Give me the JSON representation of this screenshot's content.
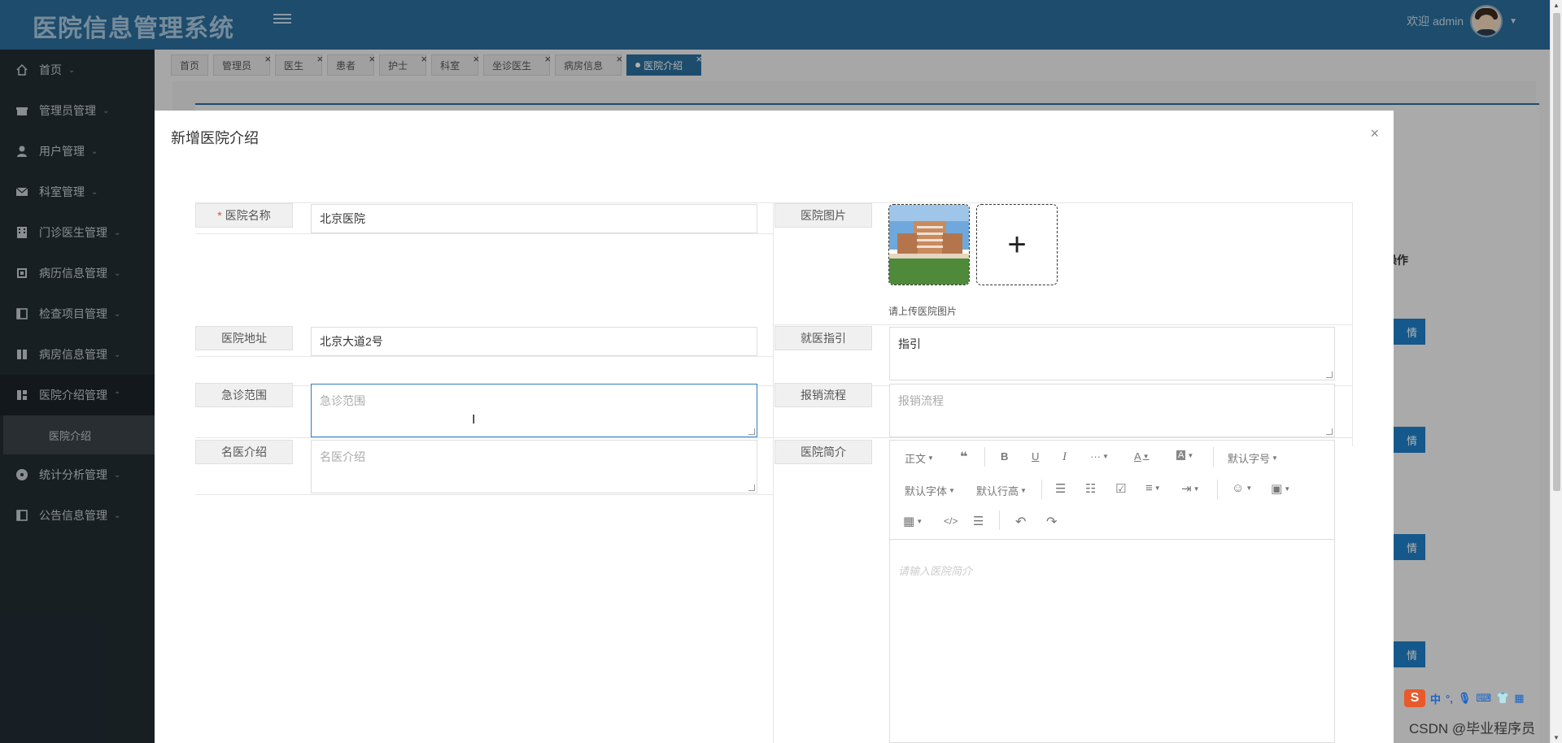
{
  "app": {
    "title": "医院信息管理系统",
    "welcome": "欢迎 admin"
  },
  "sidebar": {
    "items": [
      {
        "label": "首页",
        "icon": "home-icon"
      },
      {
        "label": "管理员管理",
        "icon": "gift-icon"
      },
      {
        "label": "用户管理",
        "icon": "user-icon"
      },
      {
        "label": "科室管理",
        "icon": "envelope-icon"
      },
      {
        "label": "门诊医生管理",
        "icon": "building-icon"
      },
      {
        "label": "病历信息管理",
        "icon": "chip-icon"
      },
      {
        "label": "检查项目管理",
        "icon": "panel-icon"
      },
      {
        "label": "病房信息管理",
        "icon": "columns-icon"
      },
      {
        "label": "医院介绍管理",
        "icon": "grid-icon"
      },
      {
        "label": "统计分析管理",
        "icon": "circle-icon"
      },
      {
        "label": "公告信息管理",
        "icon": "panel-icon"
      }
    ],
    "sub_item": "医院介绍"
  },
  "tabs": [
    {
      "label": "首页",
      "closable": false
    },
    {
      "label": "管理员",
      "closable": true
    },
    {
      "label": "医生",
      "closable": true
    },
    {
      "label": "患者",
      "closable": true
    },
    {
      "label": "护士",
      "closable": true
    },
    {
      "label": "科室",
      "closable": true
    },
    {
      "label": "坐诊医生",
      "closable": true
    },
    {
      "label": "病房信息",
      "closable": true
    },
    {
      "label": "医院介绍",
      "closable": true,
      "active": true
    }
  ],
  "background": {
    "op_header": "操作",
    "btn_label": "情"
  },
  "dialog": {
    "title": "新增医院介绍",
    "close": "×",
    "fields": {
      "name_label": "医院名称",
      "name_value": "北京医院",
      "image_label": "医院图片",
      "image_tip": "请上传医院图片",
      "add_symbol": "+",
      "address_label": "医院地址",
      "address_value": "北京大道2号",
      "guide_label": "就医指引",
      "guide_value": "指引",
      "emergency_label": "急诊范围",
      "emergency_placeholder": "急诊范围",
      "reimburse_label": "报销流程",
      "reimburse_placeholder": "报销流程",
      "doctors_label": "名医介绍",
      "doctors_placeholder": "名医介绍",
      "intro_label": "医院简介"
    },
    "editor": {
      "paragraph": "正文",
      "font_size": "默认字号",
      "font_family": "默认字体",
      "line_height": "默认行高",
      "more": "···",
      "placeholder": "请输入医院简介"
    }
  },
  "watermark": {
    "ime": "中",
    "csdn": "CSDN @毕业程序员"
  },
  "colors": {
    "header": "#2a6d9b",
    "sidebar": "#232d33",
    "accent": "#1f7fc7"
  }
}
